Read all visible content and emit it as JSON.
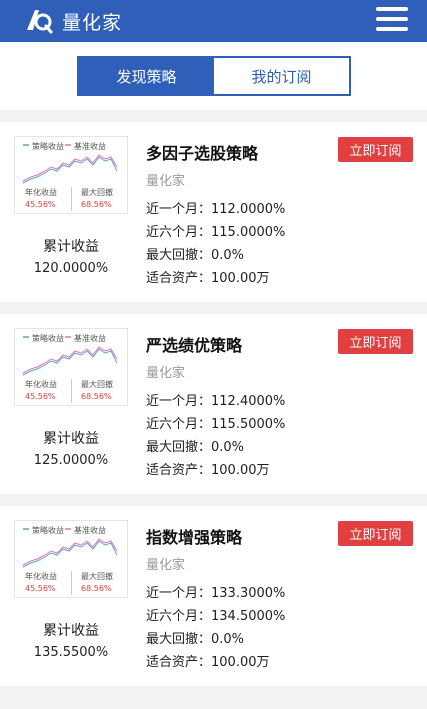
{
  "app": {
    "title": "量化家"
  },
  "tabs": [
    {
      "label": "发现策略",
      "active": true
    },
    {
      "label": "我的订阅",
      "active": false
    }
  ],
  "thumbnail": {
    "legend_a": "策略收益",
    "legend_b": "基准收益",
    "annual_label": "年化收益",
    "annual_value": "45.56%",
    "drawdown_label": "最大回撤",
    "drawdown_value": "68.56%"
  },
  "strategies": [
    {
      "name": "多因子选股策略",
      "brand": "量化家",
      "subscribe_label": "立即订阅",
      "cumulative_label": "累计收益",
      "cumulative_value": "120.0000%",
      "month1": "近一个月：112.0000%",
      "month6": "近六个月：115.0000%",
      "drawdown": "最大回撤：0.0%",
      "assets": "适合资产：100.00万"
    },
    {
      "name": "严选绩优策略",
      "brand": "量化家",
      "subscribe_label": "立即订阅",
      "cumulative_label": "累计收益",
      "cumulative_value": "125.0000%",
      "month1": "近一个月：112.4000%",
      "month6": "近六个月：115.5000%",
      "drawdown": "最大回撤：0.0%",
      "assets": "适合资产：100.00万"
    },
    {
      "name": "指数增强策略",
      "brand": "量化家",
      "subscribe_label": "立即订阅",
      "cumulative_label": "累计收益",
      "cumulative_value": "135.5500%",
      "month1": "近一个月：133.3000%",
      "month6": "近六个月：134.5000%",
      "drawdown": "最大回撤：0.0%",
      "assets": "适合资产：100.00万"
    }
  ],
  "colors": {
    "brand_blue": "#2f5fb8",
    "subscribe_red": "#e0403f",
    "line_blue": "#5aa0d8",
    "line_pink": "#e07a9a"
  }
}
